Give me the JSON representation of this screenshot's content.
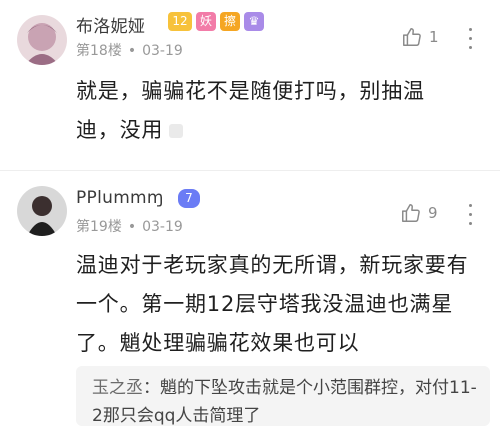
{
  "post1": {
    "username": "布洛妮娅",
    "badges": {
      "level": "12",
      "tag1": "妖",
      "tag2": "擦"
    },
    "floor": "第18楼",
    "date": "03-19",
    "likes": "1",
    "content": "就是，骗骗花不是随便打吗，别抽温迪，没用"
  },
  "post2": {
    "username": "PPlummɱ",
    "badges": {
      "level": "7"
    },
    "floor": "第19楼",
    "date": "03-19",
    "likes": "9",
    "content": "温迪对于老玩家真的无所谓，新玩家要有一个。第一期12层守塔我没温迪也满星了。魈处理骗骗花效果也可以",
    "quote": {
      "author": "玉之丞",
      "text": "：魈的下坠攻击就是个小范围群控，对付11-2那只会qq人击简理了"
    }
  },
  "colors": {
    "accent": "#f5a623",
    "level_badge": "#f7c23b",
    "purple_badge": "#6b7cf5"
  }
}
